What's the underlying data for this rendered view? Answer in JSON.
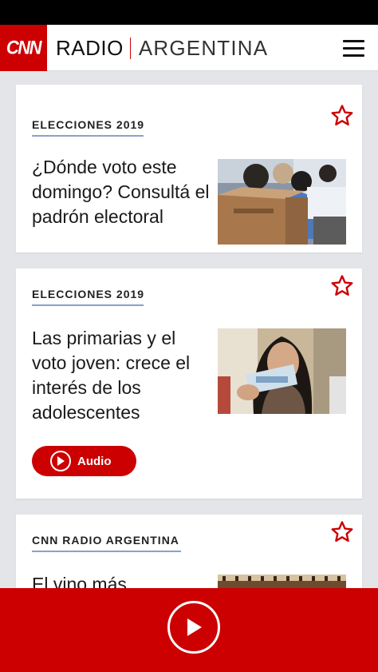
{
  "app": {
    "logo": "CNN",
    "brand_name": "RADIO",
    "brand_country": "ARGENTINA",
    "accent_color": "#cc0000",
    "menu_icon": "hamburger-menu-icon"
  },
  "articles": [
    {
      "category": "ELECCIONES 2019",
      "headline": "¿Dónde voto este domingo? Consultá el padrón electoral",
      "image": "voting-ballot-box-photo",
      "favorite_icon": "star-outline-icon"
    },
    {
      "category": "ELECCIONES 2019",
      "headline": "Las primarias y el voto joven: crece el interés de los adolescentes",
      "image": "young-voter-id-photo",
      "favorite_icon": "star-outline-icon",
      "audio_label": "Audio"
    },
    {
      "category": "CNN RADIO ARGENTINA",
      "headline": "El vino más",
      "image": "wine-cellar-photo",
      "favorite_icon": "star-outline-icon"
    }
  ],
  "player": {
    "play_icon": "play-icon"
  }
}
